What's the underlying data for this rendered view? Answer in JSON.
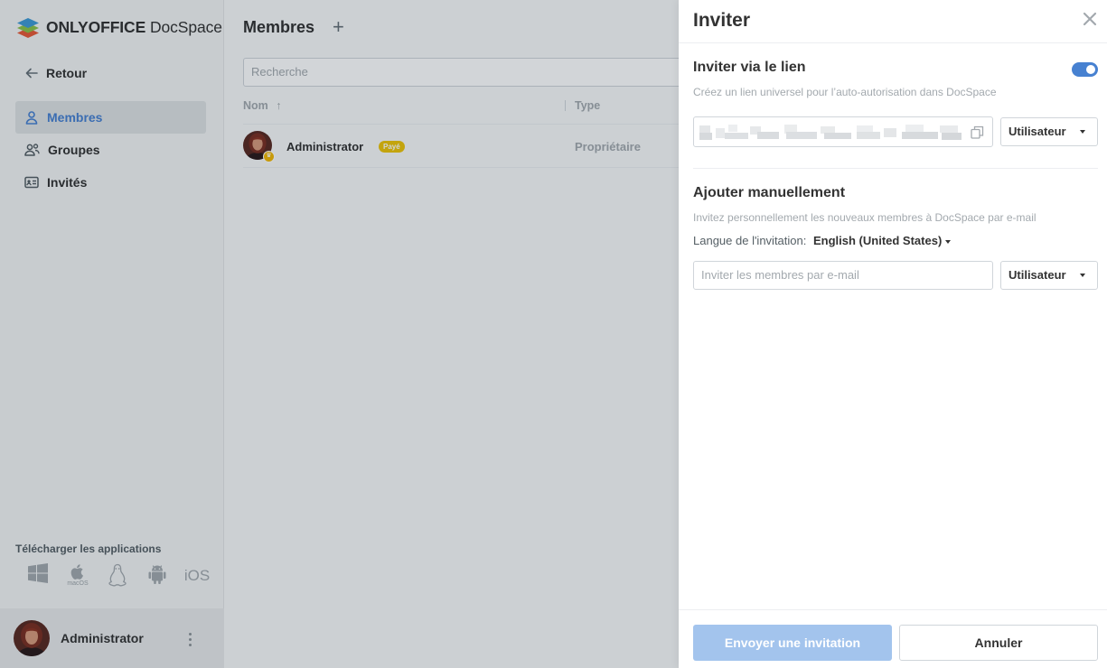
{
  "app": {
    "logo_brand": "ONLYOFFICE",
    "logo_product": "DocSpace",
    "back_label": "Retour"
  },
  "sidebar": {
    "items": [
      {
        "label": "Membres",
        "icon": "person-icon",
        "active": true
      },
      {
        "label": "Groupes",
        "icon": "group-icon",
        "active": false
      },
      {
        "label": "Invités",
        "icon": "id-card-icon",
        "active": false
      }
    ],
    "apps_title": "Télécharger les applications",
    "apps": [
      {
        "icon": "windows-icon",
        "label": ""
      },
      {
        "icon": "apple-icon",
        "label": "macOS"
      },
      {
        "icon": "linux-icon",
        "label": ""
      },
      {
        "icon": "android-icon",
        "label": ""
      },
      {
        "icon": "ios-icon",
        "label": "iOS"
      }
    ],
    "profile_name": "Administrator"
  },
  "main": {
    "title": "Membres",
    "search_placeholder": "Recherche",
    "columns": {
      "name": "Nom",
      "type": "Type"
    },
    "rows": [
      {
        "name": "Administrator",
        "badge": "Payé",
        "type": "Propriétaire"
      }
    ]
  },
  "invite": {
    "title": "Inviter",
    "link_section": {
      "title": "Inviter via le lien",
      "description": "Créez un lien universel pour l’auto-autorisation dans DocSpace",
      "enabled": true,
      "role": "Utilisateur"
    },
    "manual_section": {
      "title": "Ajouter manuellement",
      "description": "Invitez personnellement les nouveaux membres à DocSpace par e-mail",
      "language_label": "Langue de l'invitation:",
      "language_value": "English (United States)",
      "email_placeholder": "Inviter les membres par e-mail",
      "role": "Utilisateur"
    },
    "send_label": "Envoyer une invitation",
    "cancel_label": "Annuler"
  },
  "colors": {
    "accent": "#4781d1",
    "send_disabled": "#a3c4ed",
    "paid_badge": "#edc409",
    "owner_badge": "#f2b705"
  }
}
